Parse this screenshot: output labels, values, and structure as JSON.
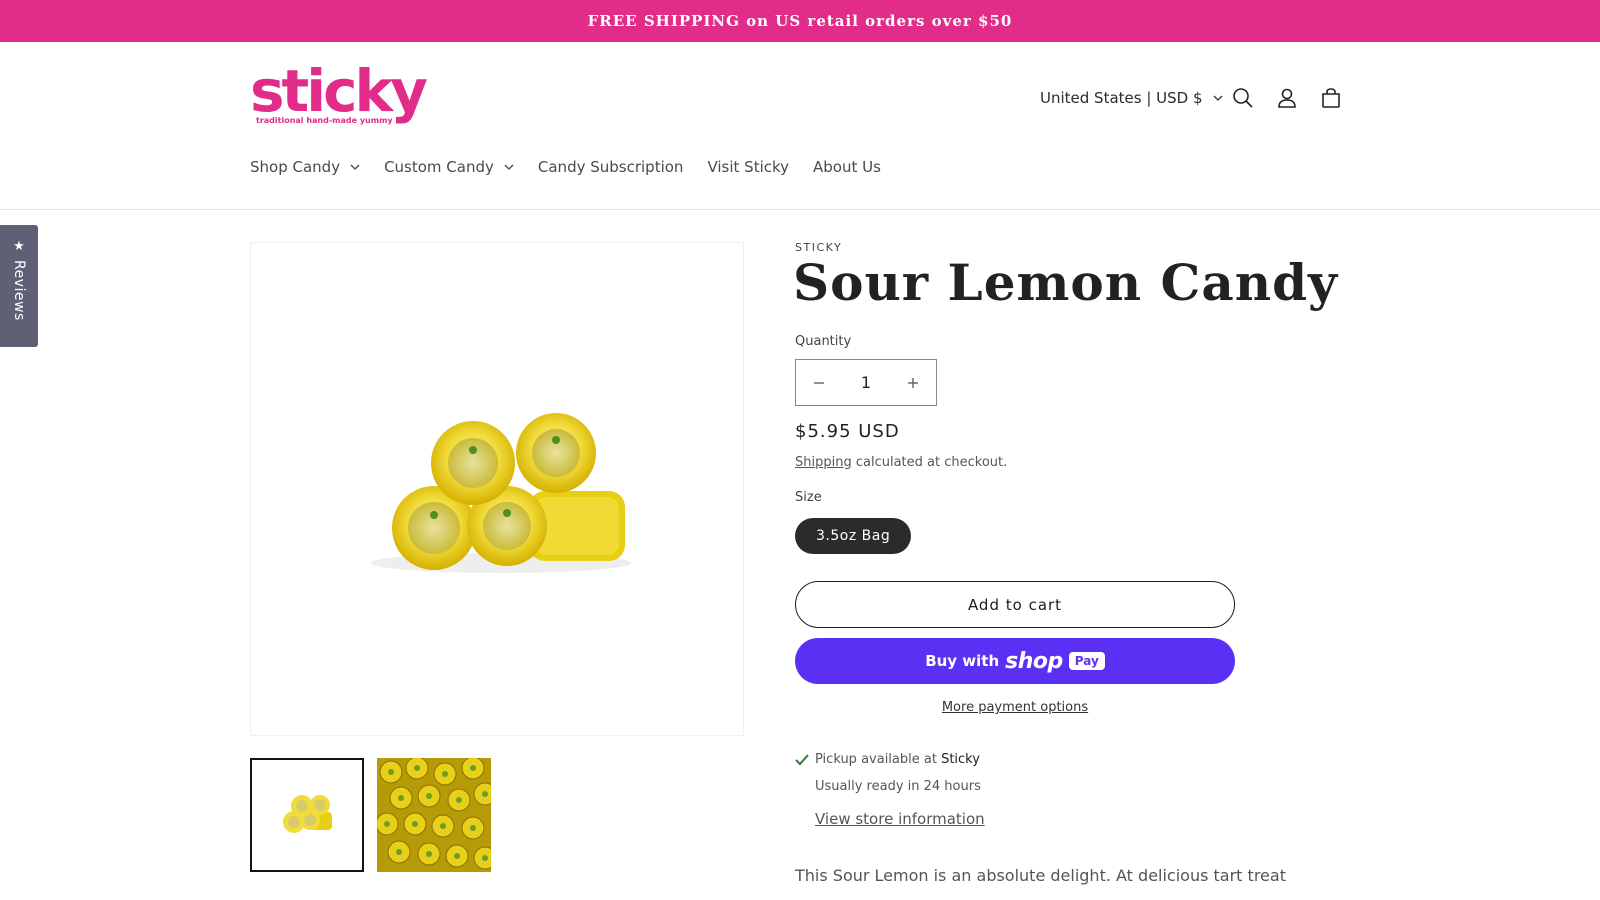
{
  "announcement": {
    "text": "FREE SHIPPING on US retail orders over $50"
  },
  "header": {
    "logo_text": "sticky",
    "logo_tagline": "traditional hand-made yummy",
    "country_selector": "United States | USD $",
    "icons": [
      "search-icon",
      "account-icon",
      "cart-icon"
    ]
  },
  "nav": {
    "items": [
      {
        "label": "Shop Candy",
        "has_dropdown": true
      },
      {
        "label": "Custom Candy",
        "has_dropdown": true
      },
      {
        "label": "Candy Subscription",
        "has_dropdown": false
      },
      {
        "label": "Visit Sticky",
        "has_dropdown": false
      },
      {
        "label": "About Us",
        "has_dropdown": false
      }
    ]
  },
  "reviews_tab": {
    "label": "Reviews"
  },
  "product": {
    "vendor": "STICKY",
    "title": "Sour Lemon Candy",
    "quantity_label": "Quantity",
    "quantity_value": "1",
    "price": "$5.95 USD",
    "shipping_link": "Shipping",
    "shipping_note": " calculated at checkout.",
    "size_label": "Size",
    "size_option": "3.5oz Bag",
    "add_to_cart": "Add to cart",
    "buy_with": "Buy with",
    "shop_pay_word": "shop",
    "shop_pay_badge": "Pay",
    "more_payment": "More payment options",
    "pickup_prefix": "Pickup available at ",
    "pickup_location": "Sticky",
    "pickup_ready": "Usually ready in 24 hours",
    "store_info": "View store information",
    "description": "This Sour Lemon is an absolute delight.  At delicious tart treat"
  },
  "colors": {
    "brand_pink": "#e22c89",
    "shop_pay_purple": "#5a31f4",
    "pill_dark": "#2b2b2b",
    "pickup_check": "#2e7d32"
  }
}
